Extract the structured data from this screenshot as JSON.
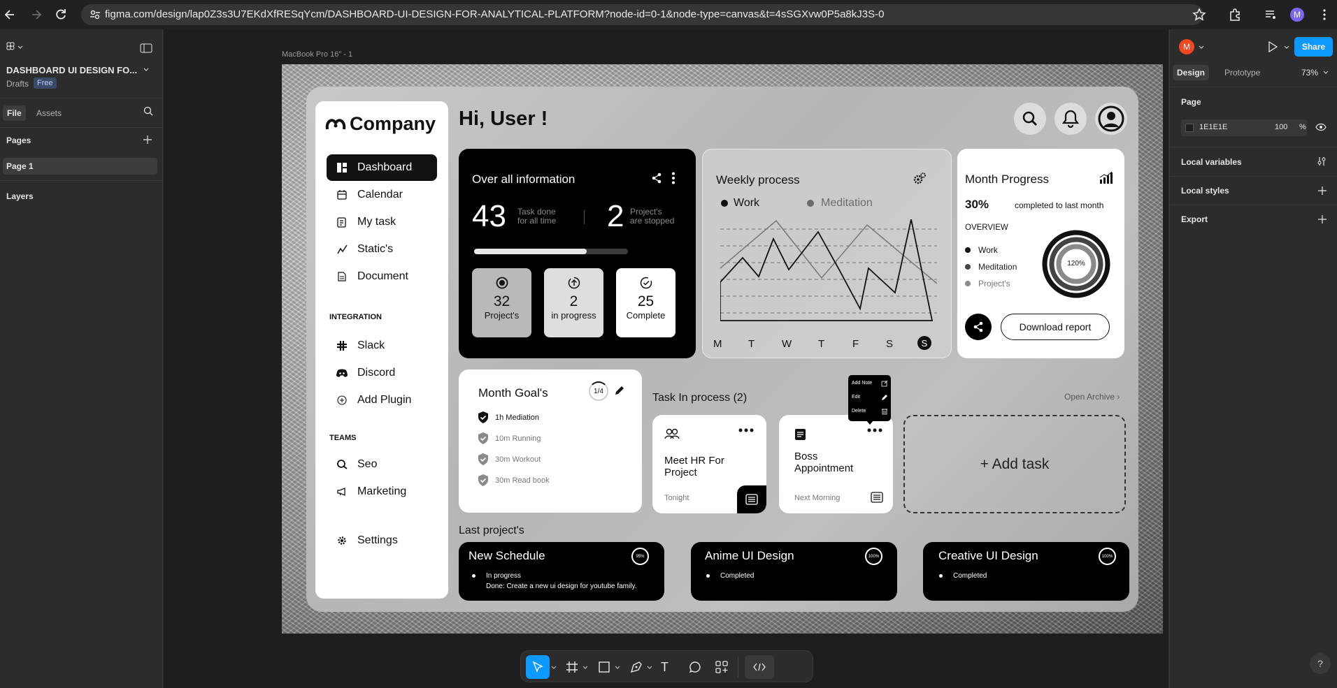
{
  "browser": {
    "url": "figma.com/design/lap0Z3s3U7EKdXfRESqYcm/DASHBOARD-UI-DESIGN-FOR-ANALYTICAL-PLATFORM?node-id=0-1&node-type=canvas&t=4sSGXvw0P5a8kJ3S-0",
    "profile_initial": "M"
  },
  "left_panel": {
    "file_title": "DASHBOARD UI DESIGN FO...",
    "drafts": "Drafts",
    "plan_badge": "Free",
    "tab_file": "File",
    "tab_assets": "Assets",
    "pages_header": "Pages",
    "page_1": "Page 1",
    "layers_header": "Layers"
  },
  "right_panel": {
    "avatar_initial": "M",
    "share_label": "Share",
    "tab_design": "Design",
    "tab_prototype": "Prototype",
    "zoom": "73%",
    "page_header": "Page",
    "bg_color": "1E1E1E",
    "bg_opacity": "100",
    "percent": "%",
    "local_variables": "Local variables",
    "local_styles": "Local styles",
    "export": "Export"
  },
  "frame_label": "MacBook Pro 16\" - 1",
  "dashboard": {
    "logo_text": "Company",
    "greeting": "Hi, User !",
    "nav": {
      "dashboard": "Dashboard",
      "calendar": "Calendar",
      "my_task": "My task",
      "statics": "Static's",
      "document": "Document"
    },
    "integration_header": "INTEGRATION",
    "integration": {
      "slack": "Slack",
      "discord": "Discord",
      "add_plugin": "Add Plugin"
    },
    "teams_header": "TEAMS",
    "teams": {
      "seo": "Seo",
      "marketing": "Marketing"
    },
    "settings": "Settings",
    "overall": {
      "title": "Over all information",
      "tasks_done": "43",
      "tasks_done_label1": "Task done",
      "tasks_done_label2": "for all time",
      "stopped": "2",
      "stopped_label1": "Project's",
      "stopped_label2": "are stopped",
      "progress": 0.73,
      "stats": [
        {
          "value": "32",
          "label": "Project's"
        },
        {
          "value": "2",
          "label": "in progress"
        },
        {
          "value": "25",
          "label": "Complete"
        }
      ]
    },
    "weekly": {
      "title": "Weekly process",
      "legend_work": "Work",
      "legend_meditation": "Meditation",
      "days": [
        "M",
        "T",
        "W",
        "T",
        "F",
        "S",
        "S"
      ]
    },
    "month_progress": {
      "title": "Month Progress",
      "percent": "30%",
      "subtitle": "completed to last month",
      "overview": "OVERVIEW",
      "legend": [
        "Work",
        "Meditation",
        "Project's"
      ],
      "ring_label": "120%",
      "download": "Download report"
    },
    "month_goals": {
      "title": "Month Goal's",
      "counter": "1/4",
      "items": [
        "1h Mediation",
        "10m Running",
        "30m Workout",
        "30m Read book"
      ]
    },
    "tasks": {
      "title": "Task In process (2)",
      "open_archive": "Open Archive",
      "cards": [
        {
          "title": "Meet HR For Project",
          "time": "Tonight"
        },
        {
          "title": "Boss Appointment",
          "time": "Next Morning"
        }
      ],
      "add_task": "+ Add task",
      "menu": [
        "Add Note",
        "Edit",
        "Delete"
      ]
    },
    "last_projects": {
      "title": "Last project's",
      "items": [
        {
          "title": "New Schedule",
          "status": "In progress",
          "detail": "Done: Create a new ui design for youtube family.",
          "badge": "95%"
        },
        {
          "title": "Anime UI Design",
          "status": "Completed",
          "badge": "100%"
        },
        {
          "title": "Creative UI Design",
          "status": "Completed",
          "badge": "100%"
        }
      ]
    }
  },
  "colors": {
    "figma_blue": "#0d99ff",
    "avatar_red": "#f24822",
    "profile_purple": "#7b68ee"
  }
}
